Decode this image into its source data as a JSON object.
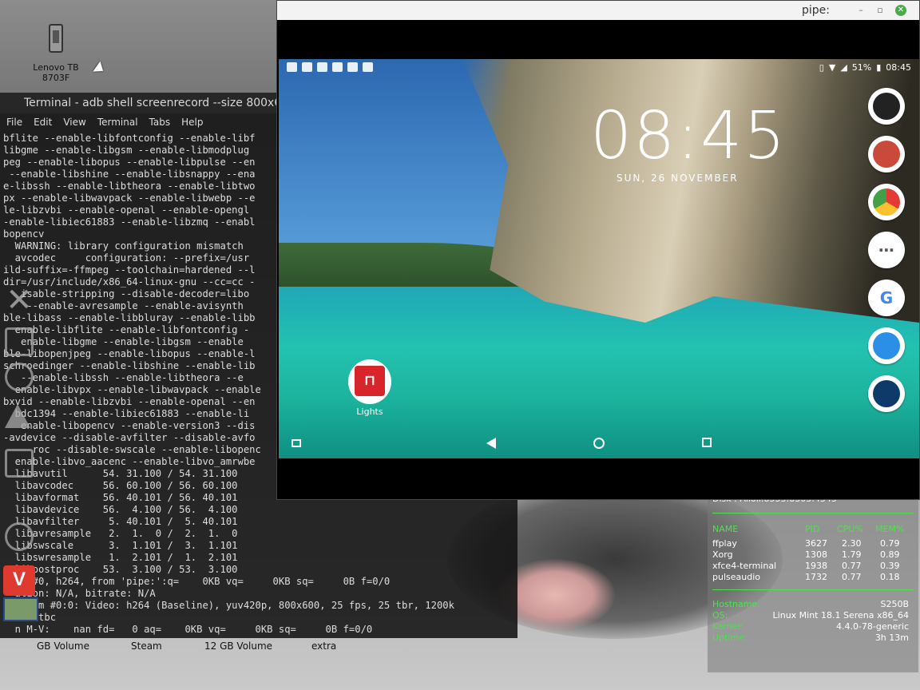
{
  "desktop": {
    "icon_label": "Lenovo TB\n8703F",
    "drives": [
      "GB Volume",
      "Steam",
      "12 GB Volume",
      "extra"
    ]
  },
  "terminal": {
    "title": "Terminal - adb shell screenrecord --size 800x6",
    "menu": [
      "File",
      "Edit",
      "View",
      "Terminal",
      "Tabs",
      "Help"
    ],
    "lines": [
      "bflite --enable-libfontconfig --enable-libf",
      "libgme --enable-libgsm --enable-libmodplug ",
      "peg --enable-libopus --enable-libpulse --en",
      " --enable-libshine --enable-libsnappy --ena",
      "e-libssh --enable-libtheora --enable-libtwo",
      "px --enable-libwavpack --enable-libwebp --e",
      "le-libzvbi --enable-openal --enable-opengl ",
      "-enable-libiec61883 --enable-libzmq --enabl",
      "bopencv",
      "  WARNING: library configuration mismatch",
      "  avcodec     configuration: --prefix=/usr ",
      "ild-suffix=-ffmpeg --toolchain=hardened --l",
      "dir=/usr/include/x86_64-linux-gnu --cc=cc -",
      "   isable-stripping --disable-decoder=libo",
      "    --enable-avresample --enable-avisynth ",
      "ble-libass --enable-libbluray --enable-libb",
      "  enable-libflite --enable-libfontconfig -",
      "   enable-libgme --enable-libgsm --enable",
      "ble-libopenjpeg --enable-libopus --enable-l",
      "schroedinger --enable-libshine --enable-lib",
      "   --enable-libssh --enable-libtheora --e",
      "  enable-libvpx --enable-libwavpack --enable",
      "bxvid --enable-libzvbi --enable-openal --en",
      "  bdc1394 --enable-libiec61883 --enable-li",
      "   enable-libopencv --enable-version3 --dis",
      "-avdevice --disable-avfilter --disable-avfo",
      "     roc --disable-swscale --enable-libopenc",
      "  enable-libvo_aacenc --enable-libvo_amrwbe",
      "  libavutil      54. 31.100 / 54. 31.100",
      "  libavcodec     56. 60.100 / 56. 60.100",
      "  libavformat    56. 40.101 / 56. 40.101",
      "  libavdevice    56.  4.100 / 56.  4.100",
      "  libavfilter     5. 40.101 /  5. 40.101",
      "  libavresample   2.  1.  0 /  2.  1.  0",
      "  libswscale      3.  1.101 /  3.  1.101",
      "  libswresample   1.  2.101 /  1.  2.101",
      "  libpostproc    53.  3.100 / 53.  3.100",
      "     #0, h264, from 'pipe:':q=    0KB vq=     0KB sq=     0B f=0/0",
      "  ation: N/A, bitrate: N/A",
      "   ream #0:0: Video: h264 (Baseline), yuv420p, 800x600, 25 fps, 25 tbr, 1200k",
      "   50 tbc",
      "  n M-V:    nan fd=   0 aq=    0KB vq=     0KB sq=     0B f=0/0"
    ]
  },
  "pipe": {
    "title": "pipe:",
    "android": {
      "status_battery": "51%",
      "status_time": "08:45",
      "clock": "08:45",
      "date": "SUN, 26 NOVEMBER",
      "app_label": "Lights"
    }
  },
  "conky": {
    "partial_top": "Disk    :     Alioli:8553:8303:4343",
    "headers": [
      "NAME",
      "PID",
      "CPU%",
      "MEM%"
    ],
    "processes": [
      {
        "name": "ffplay",
        "pid": "3627",
        "cpu": "2.30",
        "mem": "0.79"
      },
      {
        "name": "Xorg",
        "pid": "1308",
        "cpu": "1.79",
        "mem": "0.89"
      },
      {
        "name": "xfce4-terminal",
        "pid": "1938",
        "cpu": "0.77",
        "mem": "0.39"
      },
      {
        "name": "pulseaudio",
        "pid": "1732",
        "cpu": "0.77",
        "mem": "0.18"
      }
    ],
    "info": [
      {
        "k": "Hostname:",
        "v": "S250B"
      },
      {
        "k": "OS:",
        "v": "Linux Mint 18.1 Serena x86_64"
      },
      {
        "k": "Kernel:",
        "v": "4.4.0-78-generic"
      },
      {
        "k": "Uptime:",
        "v": "3h 13m"
      }
    ]
  }
}
